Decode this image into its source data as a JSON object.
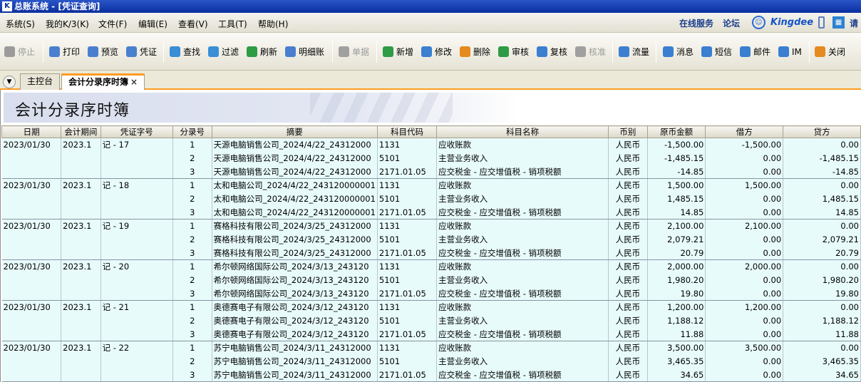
{
  "window": {
    "title": "总账系统 - [凭证查询]",
    "app_icon": "K"
  },
  "menu": [
    {
      "label": "系统(S)"
    },
    {
      "label": "我的K/3(K)"
    },
    {
      "label": "文件(F)"
    },
    {
      "label": "编辑(E)"
    },
    {
      "label": "查看(V)"
    },
    {
      "label": "工具(T)"
    },
    {
      "label": "帮助(H)"
    }
  ],
  "brand": {
    "online_service": "在线服务",
    "forum": "论坛",
    "logo": "Kingdee",
    "please": "请"
  },
  "toolbar": [
    {
      "label": "停止",
      "icon": "stop-icon",
      "color": "#9b9b9b",
      "enabled": false
    },
    {
      "label": "打印",
      "icon": "print-icon",
      "color": "#4a7fd0",
      "enabled": true
    },
    {
      "label": "预览",
      "icon": "preview-icon",
      "color": "#4a7fd0",
      "enabled": true
    },
    {
      "label": "凭证",
      "icon": "voucher-icon",
      "color": "#4a7fd0",
      "enabled": true
    },
    {
      "label": "查找",
      "icon": "find-icon",
      "color": "#3a8ed6",
      "enabled": true
    },
    {
      "label": "过滤",
      "icon": "filter-icon",
      "color": "#3a8ed6",
      "enabled": true
    },
    {
      "label": "刷新",
      "icon": "refresh-icon",
      "color": "#2e9b45",
      "enabled": true
    },
    {
      "label": "明细账",
      "icon": "ledger-icon",
      "color": "#4a7fd0",
      "enabled": true
    },
    {
      "label": "单据",
      "icon": "document-icon",
      "color": "#a0a0a0",
      "enabled": false
    },
    {
      "label": "新增",
      "icon": "add-icon",
      "color": "#2e9b45",
      "enabled": true
    },
    {
      "label": "修改",
      "icon": "edit-icon",
      "color": "#3a7fd0",
      "enabled": true
    },
    {
      "label": "删除",
      "icon": "delete-icon",
      "color": "#e58a1f",
      "enabled": true
    },
    {
      "label": "审核",
      "icon": "audit-icon",
      "color": "#2e9b45",
      "enabled": true
    },
    {
      "label": "复核",
      "icon": "recheck-icon",
      "color": "#3a7fd0",
      "enabled": true
    },
    {
      "label": "核准",
      "icon": "approve-icon",
      "color": "#a0a0a0",
      "enabled": false
    },
    {
      "label": "流量",
      "icon": "flow-icon",
      "color": "#3a7fd0",
      "enabled": true
    },
    {
      "label": "消息",
      "icon": "message-icon",
      "color": "#3a7fd0",
      "enabled": true
    },
    {
      "label": "短信",
      "icon": "sms-icon",
      "color": "#3a7fd0",
      "enabled": true
    },
    {
      "label": "邮件",
      "icon": "mail-icon",
      "color": "#3a7fd0",
      "enabled": true
    },
    {
      "label": "IM",
      "icon": "im-icon",
      "color": "#3a7fd0",
      "enabled": true
    },
    {
      "label": "关闭",
      "icon": "close-icon",
      "color": "#e58a1f",
      "enabled": true
    }
  ],
  "tabs": {
    "main": "主控台",
    "active": "会计分录序时簿",
    "close_symbol": "×"
  },
  "page_title": "会计分录序时簿",
  "table": {
    "headers": [
      "日期",
      "会计期间",
      "凭证字号",
      "分录号",
      "摘要",
      "科目代码",
      "科目名称",
      "币别",
      "原币金额",
      "借方",
      "贷方"
    ],
    "groups": [
      {
        "date": "2023/01/30",
        "period": "2023.1",
        "voucher": "记 - 17",
        "rows": [
          {
            "no": "1",
            "summary": "天源电脑销售公司_2024/4/22_24312000",
            "code": "1131",
            "account": "应收账款",
            "currency": "人民币",
            "amount": "-1,500.00",
            "debit": "-1,500.00",
            "credit": "0.00"
          },
          {
            "no": "2",
            "summary": "天源电脑销售公司_2024/4/22_24312000",
            "code": "5101",
            "account": "主营业务收入",
            "currency": "人民币",
            "amount": "-1,485.15",
            "debit": "0.00",
            "credit": "-1,485.15"
          },
          {
            "no": "3",
            "summary": "天源电脑销售公司_2024/4/22_24312000",
            "code": "2171.01.05",
            "account": "应交税金 - 应交增值税 - 销项税额",
            "currency": "人民币",
            "amount": "-14.85",
            "debit": "0.00",
            "credit": "-14.85"
          }
        ]
      },
      {
        "date": "2023/01/30",
        "period": "2023.1",
        "voucher": "记 - 18",
        "rows": [
          {
            "no": "1",
            "summary": "太和电脑公司_2024/4/22_243120000001",
            "code": "1131",
            "account": "应收账款",
            "currency": "人民币",
            "amount": "1,500.00",
            "debit": "1,500.00",
            "credit": "0.00"
          },
          {
            "no": "2",
            "summary": "太和电脑公司_2024/4/22_243120000001",
            "code": "5101",
            "account": "主营业务收入",
            "currency": "人民币",
            "amount": "1,485.15",
            "debit": "0.00",
            "credit": "1,485.15"
          },
          {
            "no": "3",
            "summary": "太和电脑公司_2024/4/22_243120000001",
            "code": "2171.01.05",
            "account": "应交税金 - 应交增值税 - 销项税额",
            "currency": "人民币",
            "amount": "14.85",
            "debit": "0.00",
            "credit": "14.85"
          }
        ]
      },
      {
        "date": "2023/01/30",
        "period": "2023.1",
        "voucher": "记 - 19",
        "rows": [
          {
            "no": "1",
            "summary": "赛格科技有限公司_2024/3/25_24312000",
            "code": "1131",
            "account": "应收账款",
            "currency": "人民币",
            "amount": "2,100.00",
            "debit": "2,100.00",
            "credit": "0.00"
          },
          {
            "no": "2",
            "summary": "赛格科技有限公司_2024/3/25_24312000",
            "code": "5101",
            "account": "主营业务收入",
            "currency": "人民币",
            "amount": "2,079.21",
            "debit": "0.00",
            "credit": "2,079.21"
          },
          {
            "no": "3",
            "summary": "赛格科技有限公司_2024/3/25_24312000",
            "code": "2171.01.05",
            "account": "应交税金 - 应交增值税 - 销项税额",
            "currency": "人民币",
            "amount": "20.79",
            "debit": "0.00",
            "credit": "20.79"
          }
        ]
      },
      {
        "date": "2023/01/30",
        "period": "2023.1",
        "voucher": "记 - 20",
        "rows": [
          {
            "no": "1",
            "summary": "希尔顿网络国际公司_2024/3/13_243120",
            "code": "1131",
            "account": "应收账款",
            "currency": "人民币",
            "amount": "2,000.00",
            "debit": "2,000.00",
            "credit": "0.00"
          },
          {
            "no": "2",
            "summary": "希尔顿网络国际公司_2024/3/13_243120",
            "code": "5101",
            "account": "主营业务收入",
            "currency": "人民币",
            "amount": "1,980.20",
            "debit": "0.00",
            "credit": "1,980.20"
          },
          {
            "no": "3",
            "summary": "希尔顿网络国际公司_2024/3/13_243120",
            "code": "2171.01.05",
            "account": "应交税金 - 应交增值税 - 销项税额",
            "currency": "人民币",
            "amount": "19.80",
            "debit": "0.00",
            "credit": "19.80"
          }
        ]
      },
      {
        "date": "2023/01/30",
        "period": "2023.1",
        "voucher": "记 - 21",
        "rows": [
          {
            "no": "1",
            "summary": "奥德赛电子有限公司_2024/3/12_243120",
            "code": "1131",
            "account": "应收账款",
            "currency": "人民币",
            "amount": "1,200.00",
            "debit": "1,200.00",
            "credit": "0.00"
          },
          {
            "no": "2",
            "summary": "奥德赛电子有限公司_2024/3/12_243120",
            "code": "5101",
            "account": "主营业务收入",
            "currency": "人民币",
            "amount": "1,188.12",
            "debit": "0.00",
            "credit": "1,188.12"
          },
          {
            "no": "3",
            "summary": "奥德赛电子有限公司_2024/3/12_243120",
            "code": "2171.01.05",
            "account": "应交税金 - 应交增值税 - 销项税额",
            "currency": "人民币",
            "amount": "11.88",
            "debit": "0.00",
            "credit": "11.88"
          }
        ]
      },
      {
        "date": "2023/01/30",
        "period": "2023.1",
        "voucher": "记 - 22",
        "rows": [
          {
            "no": "1",
            "summary": "苏宁电脑销售公司_2024/3/11_24312000",
            "code": "1131",
            "account": "应收账款",
            "currency": "人民币",
            "amount": "3,500.00",
            "debit": "3,500.00",
            "credit": "0.00"
          },
          {
            "no": "2",
            "summary": "苏宁电脑销售公司_2024/3/11_24312000",
            "code": "5101",
            "account": "主营业务收入",
            "currency": "人民币",
            "amount": "3,465.35",
            "debit": "0.00",
            "credit": "3,465.35"
          },
          {
            "no": "3",
            "summary": "苏宁电脑销售公司_2024/3/11_24312000",
            "code": "2171.01.05",
            "account": "应交税金 - 应交增值税 - 销项税额",
            "currency": "人民币",
            "amount": "34.65",
            "debit": "0.00",
            "credit": "34.65"
          }
        ]
      }
    ]
  }
}
